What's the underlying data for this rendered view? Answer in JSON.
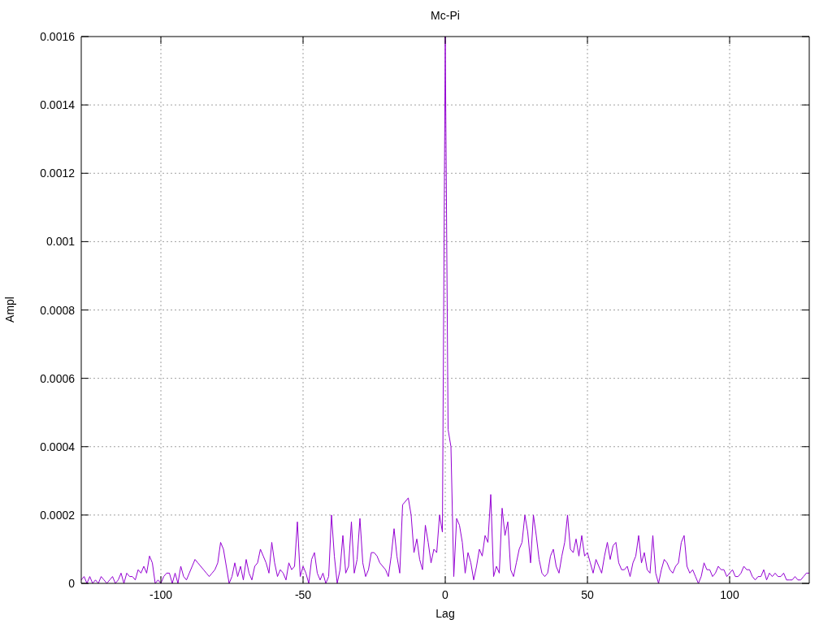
{
  "chart_data": {
    "type": "line",
    "title": "Mc-Pi",
    "xlabel": "Lag",
    "ylabel": "Ampl",
    "xlim": [
      -128,
      128
    ],
    "ylim": [
      0,
      0.0016
    ],
    "xticks": [
      -100,
      -50,
      0,
      50,
      100
    ],
    "yticks": [
      {
        "value": 0,
        "label": "0"
      },
      {
        "value": 0.0002,
        "label": "0.0002"
      },
      {
        "value": 0.0004,
        "label": "0.0004"
      },
      {
        "value": 0.0006,
        "label": "0.0006"
      },
      {
        "value": 0.0008,
        "label": "0.0008"
      },
      {
        "value": 0.001,
        "label": "0.001"
      },
      {
        "value": 0.0012,
        "label": "0.0012"
      },
      {
        "value": 0.0014,
        "label": "0.0014"
      },
      {
        "value": 0.0016,
        "label": "0.0016"
      }
    ],
    "x": [
      -128,
      -127,
      -126,
      -125,
      -124,
      -123,
      -122,
      -121,
      -120,
      -119,
      -118,
      -117,
      -116,
      -115,
      -114,
      -113,
      -112,
      -111,
      -110,
      -109,
      -108,
      -107,
      -106,
      -105,
      -104,
      -103,
      -102,
      -101,
      -100,
      -99,
      -98,
      -97,
      -96,
      -95,
      -94,
      -93,
      -92,
      -91,
      -90,
      -89,
      -88,
      -87,
      -86,
      -85,
      -84,
      -83,
      -82,
      -81,
      -80,
      -79,
      -78,
      -77,
      -76,
      -75,
      -74,
      -73,
      -72,
      -71,
      -70,
      -69,
      -68,
      -67,
      -66,
      -65,
      -64,
      -63,
      -62,
      -61,
      -60,
      -59,
      -58,
      -57,
      -56,
      -55,
      -54,
      -53,
      -52,
      -51,
      -50,
      -49,
      -48,
      -47,
      -46,
      -45,
      -44,
      -43,
      -42,
      -41,
      -40,
      -39,
      -38,
      -37,
      -36,
      -35,
      -34,
      -33,
      -32,
      -31,
      -30,
      -29,
      -28,
      -27,
      -26,
      -25,
      -24,
      -23,
      -22,
      -21,
      -20,
      -19,
      -18,
      -17,
      -16,
      -15,
      -14,
      -13,
      -12,
      -11,
      -10,
      -9,
      -8,
      -7,
      -6,
      -5,
      -4,
      -3,
      -2,
      -1,
      0,
      1,
      2,
      3,
      4,
      5,
      6,
      7,
      8,
      9,
      10,
      11,
      12,
      13,
      14,
      15,
      16,
      17,
      18,
      19,
      20,
      21,
      22,
      23,
      24,
      25,
      26,
      27,
      28,
      29,
      30,
      31,
      32,
      33,
      34,
      35,
      36,
      37,
      38,
      39,
      40,
      41,
      42,
      43,
      44,
      45,
      46,
      47,
      48,
      49,
      50,
      51,
      52,
      53,
      54,
      55,
      56,
      57,
      58,
      59,
      60,
      61,
      62,
      63,
      64,
      65,
      66,
      67,
      68,
      69,
      70,
      71,
      72,
      73,
      74,
      75,
      76,
      77,
      78,
      79,
      80,
      81,
      82,
      83,
      84,
      85,
      86,
      87,
      88,
      89,
      90,
      91,
      92,
      93,
      94,
      95,
      96,
      97,
      98,
      99,
      100,
      101,
      102,
      103,
      104,
      105,
      106,
      107,
      108,
      109,
      110,
      111,
      112,
      113,
      114,
      115,
      116,
      117,
      118,
      119,
      120,
      121,
      122,
      123,
      124,
      125,
      126,
      127,
      128
    ],
    "grid": true,
    "series": [
      {
        "color": "#9400d3",
        "values": [
          1e-05,
          2e-05,
          0,
          2e-05,
          0,
          1e-05,
          0,
          2e-05,
          1e-05,
          0,
          1e-05,
          2e-05,
          0,
          1e-05,
          3e-05,
          0,
          3e-05,
          2e-05,
          2e-05,
          1e-05,
          4e-05,
          3e-05,
          5e-05,
          3e-05,
          8e-05,
          6e-05,
          0,
          1e-05,
          0,
          2e-05,
          3e-05,
          3e-05,
          0,
          3e-05,
          0,
          5e-05,
          2e-05,
          1e-05,
          3e-05,
          5e-05,
          7e-05,
          6e-05,
          5e-05,
          4e-05,
          3e-05,
          2e-05,
          3e-05,
          4e-05,
          6e-05,
          0.00012,
          0.0001,
          5e-05,
          0,
          2e-05,
          6e-05,
          2e-05,
          5e-05,
          1e-05,
          7e-05,
          3e-05,
          1e-05,
          5e-05,
          6e-05,
          0.0001,
          8e-05,
          6e-05,
          3e-05,
          0.00012,
          6e-05,
          2e-05,
          4e-05,
          3e-05,
          1e-05,
          6e-05,
          4e-05,
          5e-05,
          0.00018,
          2e-05,
          5e-05,
          3e-05,
          0,
          7e-05,
          9e-05,
          3e-05,
          1e-05,
          3e-05,
          0,
          2e-05,
          0.0002,
          8e-05,
          0,
          4e-05,
          0.00014,
          3e-05,
          5e-05,
          0.00018,
          3e-05,
          7e-05,
          0.00019,
          6e-05,
          2e-05,
          4e-05,
          9e-05,
          9e-05,
          8e-05,
          6e-05,
          5e-05,
          4e-05,
          2e-05,
          8e-05,
          0.00016,
          8e-05,
          3e-05,
          0.00023,
          0.00024,
          0.00025,
          0.0002,
          9e-05,
          0.00013,
          7e-05,
          4e-05,
          0.00017,
          0.00012,
          6e-05,
          0.0001,
          9e-05,
          0.0002,
          0.00015,
          0.0016,
          0.00045,
          0.0004,
          2e-05,
          0.00019,
          0.00017,
          0.00012,
          3e-05,
          9e-05,
          6e-05,
          1e-05,
          5e-05,
          0.0001,
          8e-05,
          0.00014,
          0.00012,
          0.00026,
          2e-05,
          5e-05,
          3e-05,
          0.00022,
          0.00014,
          0.00018,
          4e-05,
          2e-05,
          6e-05,
          0.0001,
          0.00012,
          0.0002,
          0.00015,
          6e-05,
          0.0002,
          0.00014,
          7e-05,
          3e-05,
          2e-05,
          3e-05,
          8e-05,
          0.0001,
          5e-05,
          3e-05,
          8e-05,
          0.00012,
          0.0002,
          0.0001,
          9e-05,
          0.00013,
          8e-05,
          0.00014,
          8e-05,
          9e-05,
          6e-05,
          3e-05,
          7e-05,
          5e-05,
          3e-05,
          8e-05,
          0.00012,
          7e-05,
          0.00011,
          0.00012,
          6e-05,
          4e-05,
          4e-05,
          5e-05,
          2e-05,
          6e-05,
          8e-05,
          0.00014,
          6e-05,
          9e-05,
          4e-05,
          3e-05,
          0.00014,
          3e-05,
          0,
          4e-05,
          7e-05,
          6e-05,
          4e-05,
          3e-05,
          5e-05,
          6e-05,
          0.00012,
          0.00014,
          5e-05,
          3e-05,
          4e-05,
          2e-05,
          0,
          2e-05,
          6e-05,
          4e-05,
          4e-05,
          2e-05,
          3e-05,
          5e-05,
          4e-05,
          4e-05,
          2e-05,
          3e-05,
          4e-05,
          2e-05,
          2e-05,
          3e-05,
          5e-05,
          4e-05,
          4e-05,
          2e-05,
          1e-05,
          2e-05,
          2e-05,
          4e-05,
          1e-05,
          3e-05,
          2e-05,
          3e-05,
          2e-05,
          2e-05,
          3e-05,
          1e-05,
          1e-05,
          1e-05,
          2e-05,
          1e-05,
          1e-05,
          2e-05,
          3e-05,
          3e-05
        ]
      }
    ]
  }
}
